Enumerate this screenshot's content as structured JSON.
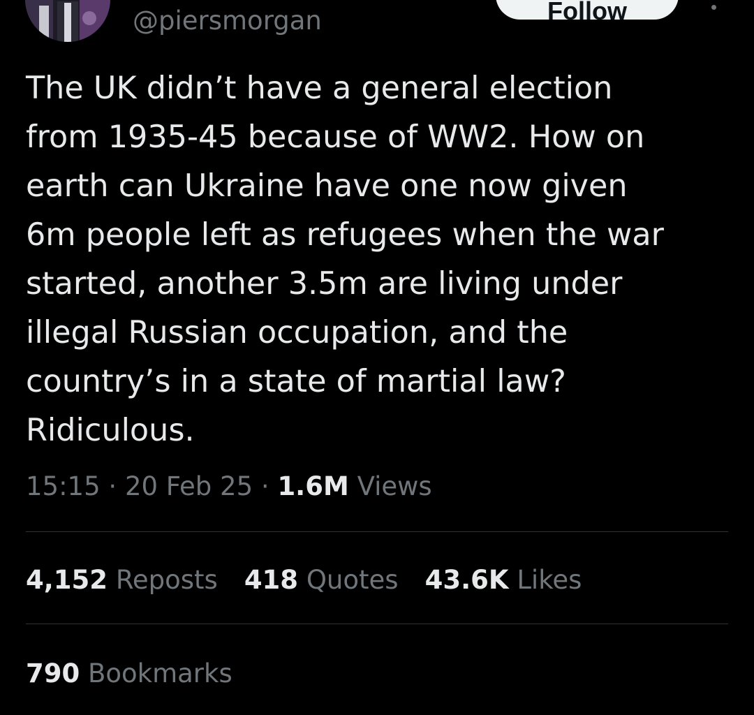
{
  "author": {
    "handle": "@piersmorgan"
  },
  "follow_label": "Follow",
  "tweet": {
    "text": "The UK didn’t have a general election\nfrom 1935-45 because of WW2.  How on\nearth can Ukraine have one now given\n6m people left as refugees when the war\nstarted, another 3.5m are living under\nillegal Russian occupation, and the\ncountry’s in a state of martial law?\nRidiculous.",
    "time": "15:15",
    "date": "20 Feb 25",
    "separator": " · ",
    "views_count": "1.6M",
    "views_label": "Views"
  },
  "stats": {
    "reposts_count": "4,152",
    "reposts_label": "Reposts",
    "quotes_count": "418",
    "quotes_label": "Quotes",
    "likes_count": "43.6K",
    "likes_label": "Likes",
    "bookmarks_count": "790",
    "bookmarks_label": "Bookmarks"
  },
  "colors": {
    "background": "#000000",
    "primary_text": "#e7e9ea",
    "secondary_text": "#71767b",
    "divider": "#2f3336",
    "follow_button_bg": "#eff3f4"
  },
  "icons": {
    "more": "more-horizontal-icon"
  }
}
